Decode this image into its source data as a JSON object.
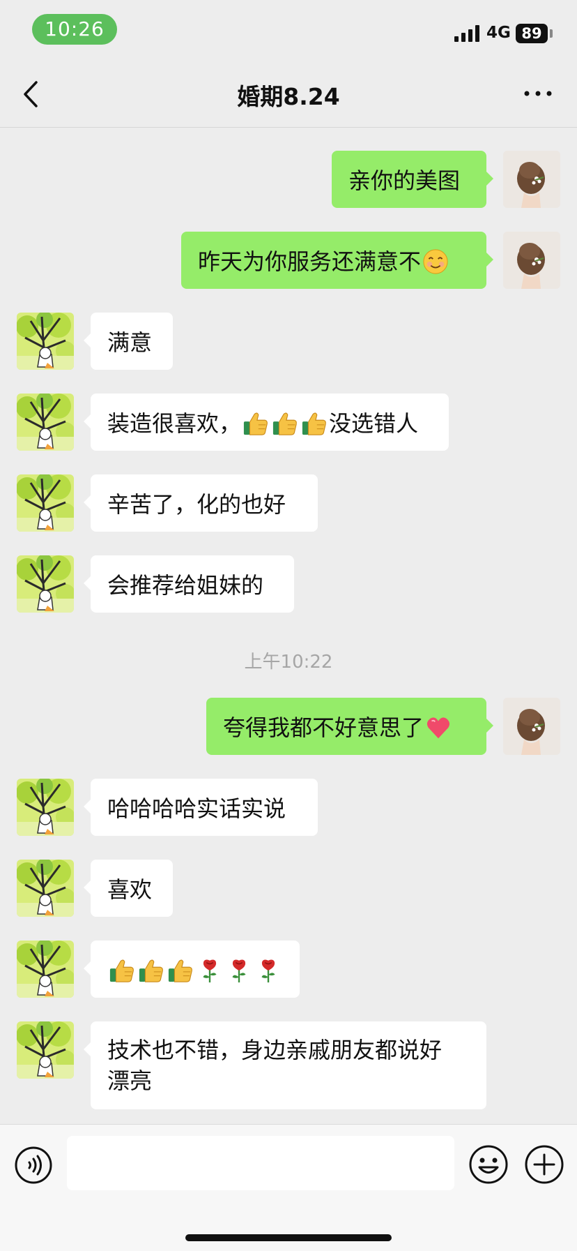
{
  "status_bar": {
    "time": "10:26",
    "network": "4G",
    "battery": "89"
  },
  "nav": {
    "title": "婚期8.24"
  },
  "messages": [
    {
      "side": "out",
      "text": "亲你的美图"
    },
    {
      "side": "out",
      "text": "昨天为你服务还满意不",
      "emoji": [
        "smiling-face"
      ]
    },
    {
      "side": "in",
      "text": "满意"
    },
    {
      "side": "in",
      "text_before": "装造很喜欢，",
      "emoji": [
        "thumbs-up",
        "thumbs-up",
        "thumbs-up"
      ],
      "text_after": "没选错人"
    },
    {
      "side": "in",
      "text": "辛苦了，化的也好"
    },
    {
      "side": "in",
      "text": "会推荐给姐妹的"
    },
    {
      "side": "out",
      "text": "夸得我都不好意思了",
      "emoji": [
        "heart"
      ]
    },
    {
      "side": "in",
      "text": "哈哈哈哈实话实说"
    },
    {
      "side": "in",
      "text": "喜欢"
    },
    {
      "side": "in",
      "emoji": [
        "thumbs-up",
        "thumbs-up",
        "thumbs-up",
        "rose",
        "rose",
        "rose"
      ]
    },
    {
      "side": "in",
      "line1": "技术也不错，身边亲戚朋友都说好",
      "line2": "漂亮"
    }
  ],
  "timestamp": "上午10:22",
  "input": {
    "placeholder": ""
  },
  "colors": {
    "outgoing_bubble": "#95ec69",
    "incoming_bubble": "#ffffff",
    "background": "#ededed",
    "time_pill": "#5cbf5c"
  },
  "icons": [
    "back-icon",
    "more-icon",
    "voice-icon",
    "emoji-icon",
    "plus-icon"
  ]
}
